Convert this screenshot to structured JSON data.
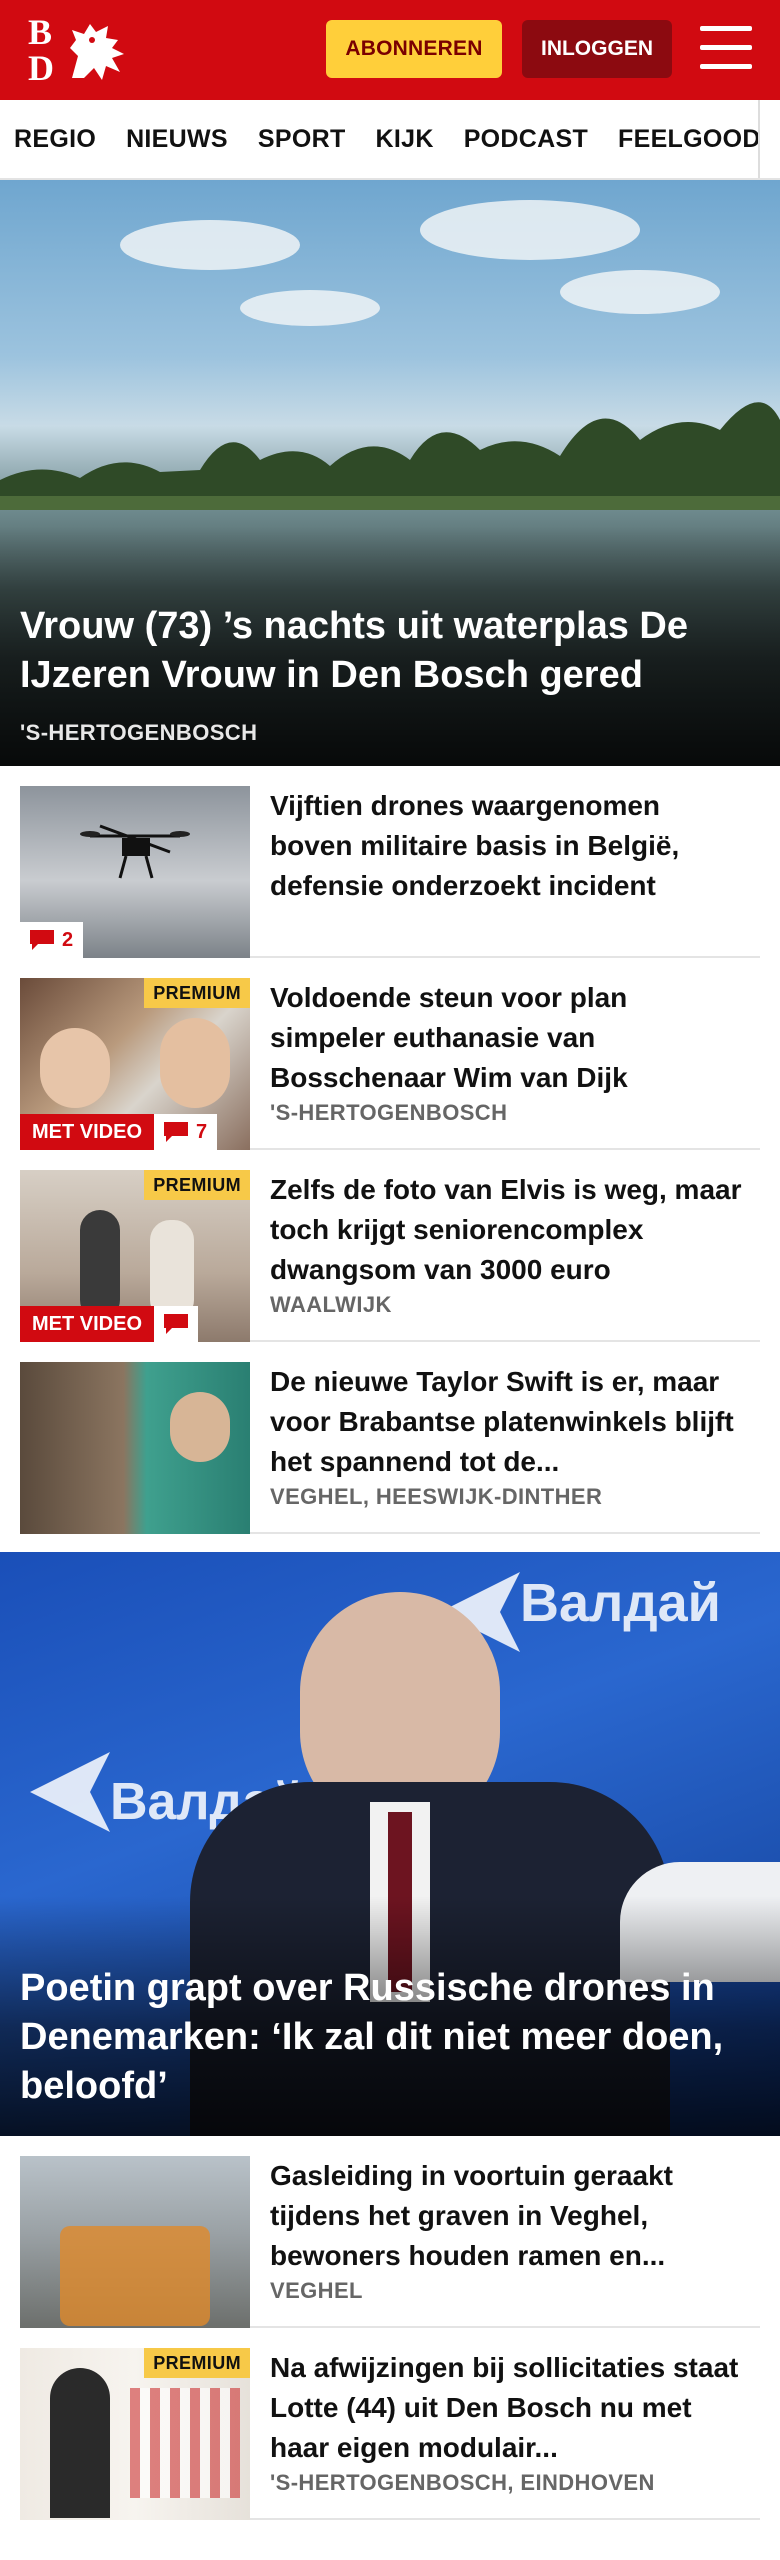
{
  "header": {
    "logo_top": "B",
    "logo_bottom": "D",
    "subscribe_label": "ABONNEREN",
    "login_label": "INLOGGEN",
    "brand_color": "#d10a11",
    "subscribe_color": "#ffcf3a"
  },
  "nav": {
    "items": [
      "REGIO",
      "NIEUWS",
      "SPORT",
      "KIJK",
      "PODCAST",
      "FEELGOOD"
    ]
  },
  "hero1": {
    "title": "Vrouw (73) ’s nachts uit waterplas De IJzeren Vrouw in Den Bosch gered",
    "location": "'S-HERTOGENBOSCH"
  },
  "articles": [
    {
      "title": "Vijftien drones waargenomen boven militaire basis in België, defensie onderzoekt incident",
      "location": "",
      "premium": "",
      "video": "",
      "comments": "2"
    },
    {
      "title": "Voldoende steun voor plan simpeler euthanasie van Bosschenaar Wim van Dijk",
      "location": "'S-HERTOGENBOSCH",
      "premium": "PREMIUM",
      "video": "MET VIDEO",
      "comments": "7"
    },
    {
      "title": "Zelfs de foto van Elvis is weg, maar toch krijgt seniorencom­plex dwangsom van 3000 euro",
      "location": "WAALWIJK",
      "premium": "PREMIUM",
      "video": "MET VIDEO",
      "comments": ""
    },
    {
      "title": "De nieuwe Taylor Swift is er, maar voor Brabantse platenwin­kels blijft het spannend tot de...",
      "location": "VEGHEL, HEESWIJK-DINTHER",
      "premium": "",
      "video": "",
      "comments": ""
    }
  ],
  "hero2": {
    "title": "Poetin grapt over Russische drones in Denemarken: ‘Ik zal dit niet meer doen, beloofd’",
    "backdrop_text": "Валдай"
  },
  "articles2": [
    {
      "title": "Gasleiding in voortuin geraakt tijdens het graven in Veghel, bewoners houden ramen en...",
      "location": "VEGHEL",
      "premium": ""
    },
    {
      "title": "Na afwijzingen bij sollicitaties staat Lotte (44) uit Den Bosch nu met haar eigen modulair...",
      "location": "'S-HERTOGENBOSCH, EINDHOVEN",
      "premium": "PREMIUM"
    }
  ]
}
